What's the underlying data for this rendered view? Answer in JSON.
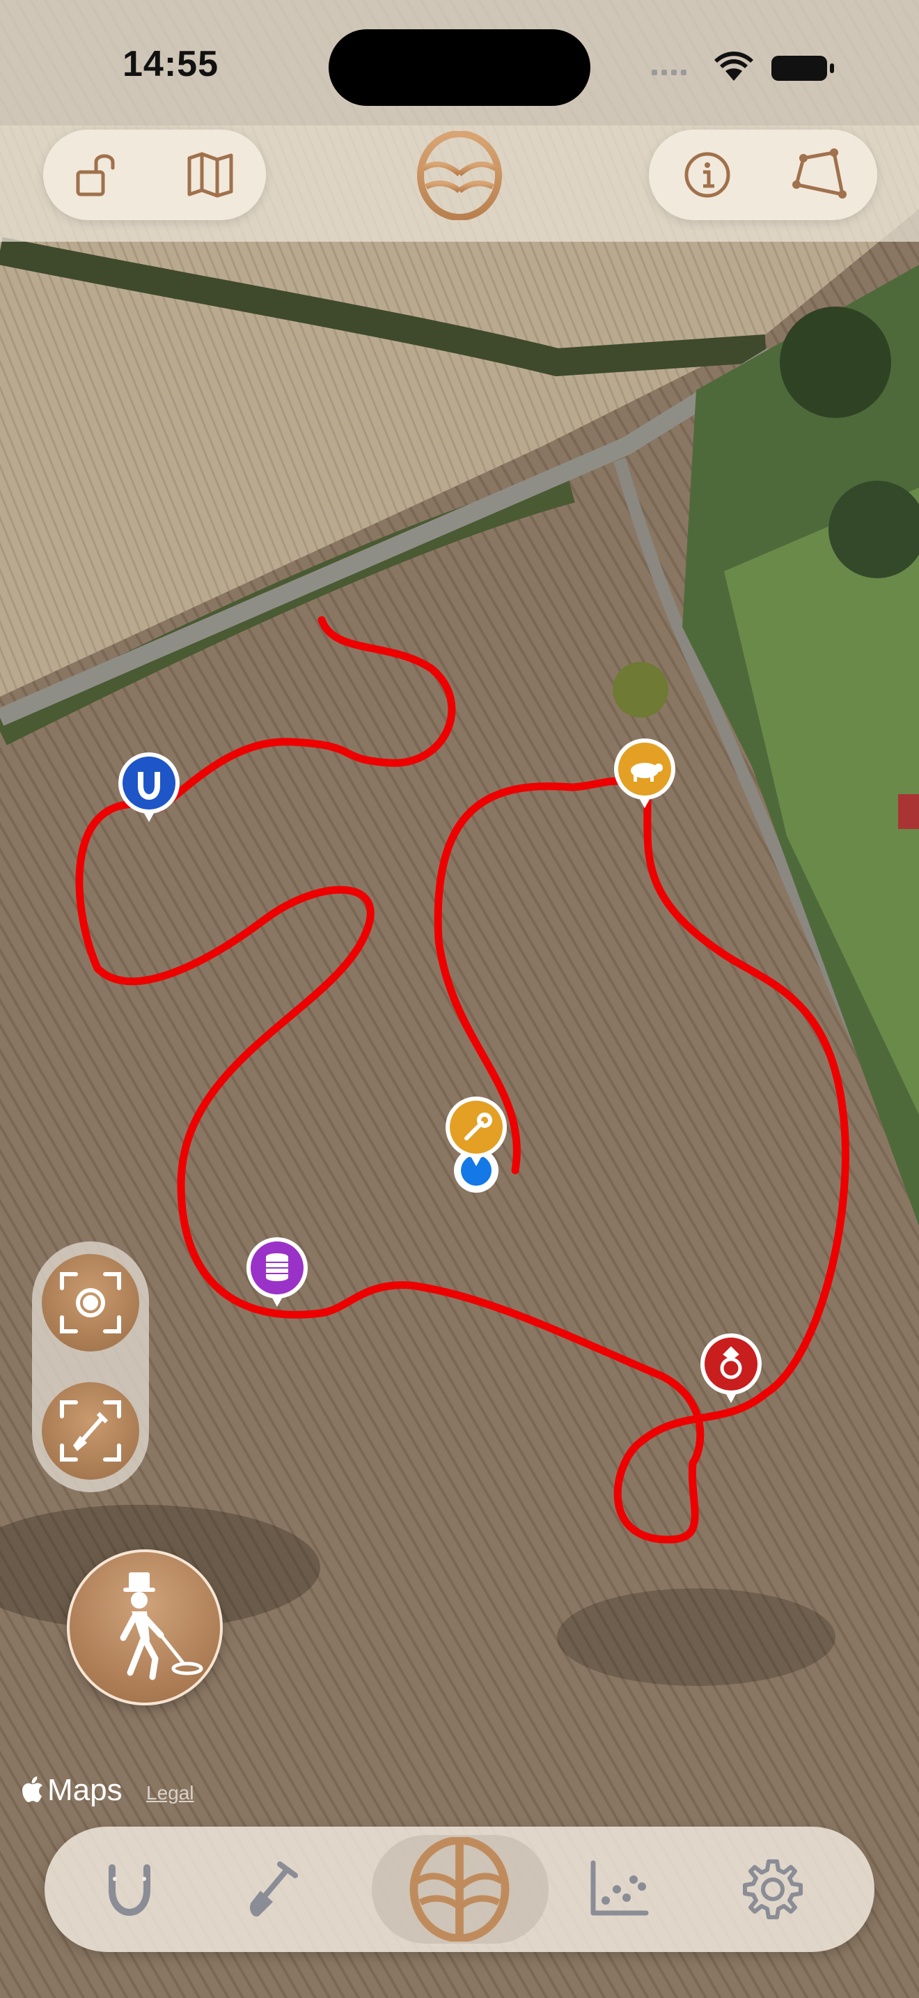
{
  "status_bar": {
    "time": "14:55"
  },
  "top_toolbar": {
    "left_buttons": [
      {
        "icon": "unlock-icon"
      },
      {
        "icon": "map-icon"
      }
    ],
    "center_logo": {
      "icon": "detector-logo-icon"
    },
    "right_buttons": [
      {
        "icon": "info-icon"
      },
      {
        "icon": "polygon-area-icon"
      }
    ]
  },
  "map": {
    "type": "satellite",
    "track_color": "#ee0000",
    "finds": [
      {
        "kind": "horseshoe",
        "color": "#1e56c8",
        "icon": "horseshoe-icon"
      },
      {
        "kind": "animal",
        "color": "#e3a024",
        "icon": "pig-icon"
      },
      {
        "kind": "tool",
        "color": "#e3a024",
        "icon": "wrench-icon"
      },
      {
        "kind": "coins",
        "color": "#9b32c8",
        "icon": "coins-icon"
      },
      {
        "kind": "ring",
        "color": "#c81e1e",
        "icon": "ring-icon"
      }
    ]
  },
  "side_controls": {
    "buttons": [
      {
        "icon": "focus-location-icon"
      },
      {
        "icon": "focus-dig-icon"
      }
    ],
    "record_button": {
      "icon": "detectorist-walking-icon"
    }
  },
  "attribution": {
    "maps_label": "Maps",
    "legal_label": "Legal"
  },
  "tab_bar": {
    "tabs": [
      {
        "icon": "horseshoe-icon",
        "active": false
      },
      {
        "icon": "shovel-icon",
        "active": false
      },
      {
        "icon": "detector-logo-icon",
        "active": true
      },
      {
        "icon": "scatter-chart-icon",
        "active": false
      },
      {
        "icon": "gear-icon",
        "active": false
      }
    ]
  },
  "colors": {
    "accent": "#b8845a",
    "accent_dark": "#9b6d46",
    "icon_brown": "#a0714c",
    "tab_gray": "#8a8d95"
  }
}
